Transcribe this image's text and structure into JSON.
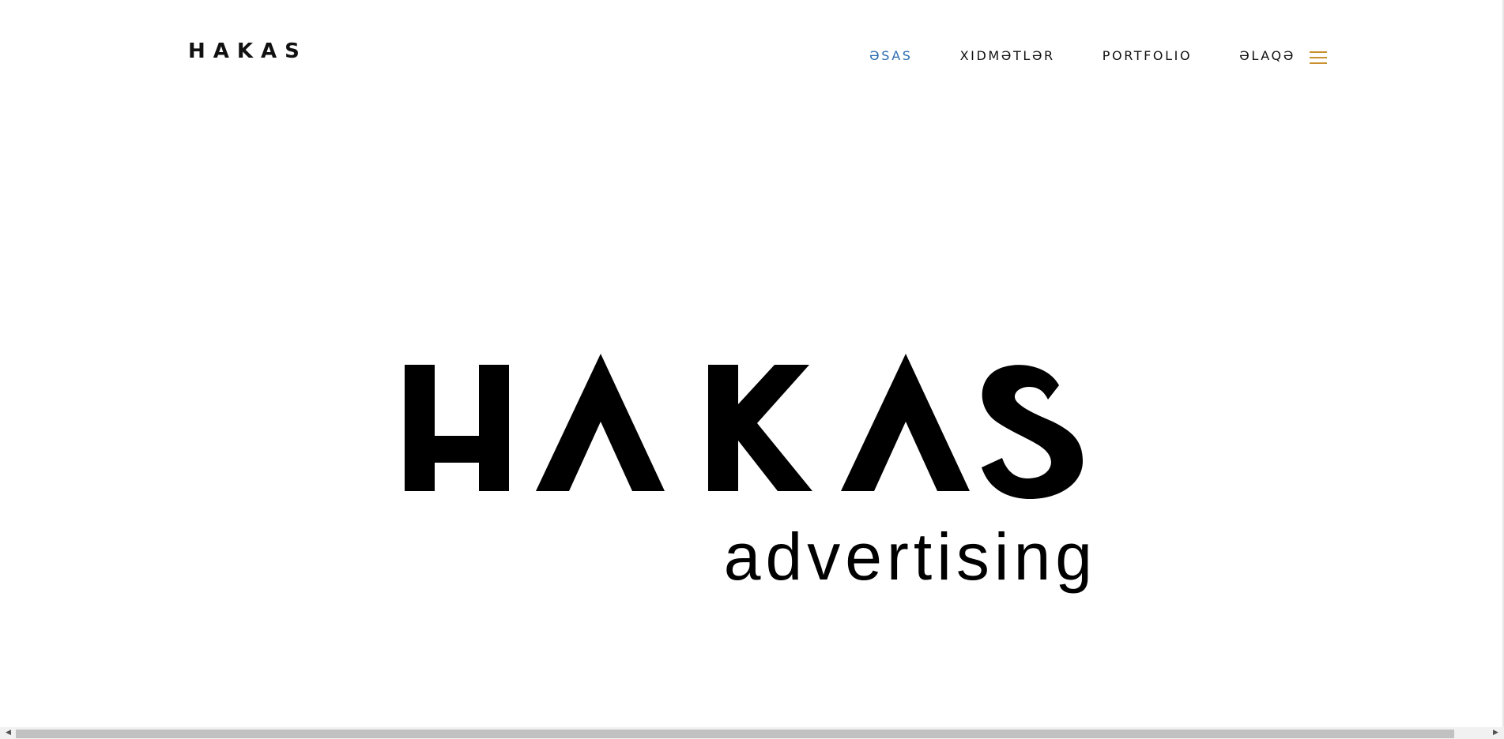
{
  "header": {
    "brand": "HAKAS"
  },
  "nav": {
    "items": [
      {
        "label": "ƏSAS",
        "active": true
      },
      {
        "label": "XIDMƏTLƏR",
        "active": false
      },
      {
        "label": "PORTFOLIO",
        "active": false
      },
      {
        "label": "ƏLAQƏ",
        "active": false
      }
    ],
    "menu_icon": "hamburger-menu-icon"
  },
  "hero": {
    "logo_word": "HAKAS",
    "logo_tagline": "advertising"
  },
  "colors": {
    "active_link": "#2b6cb0",
    "menu_icon": "#c8902f",
    "text": "#111111",
    "logo": "#000000"
  }
}
